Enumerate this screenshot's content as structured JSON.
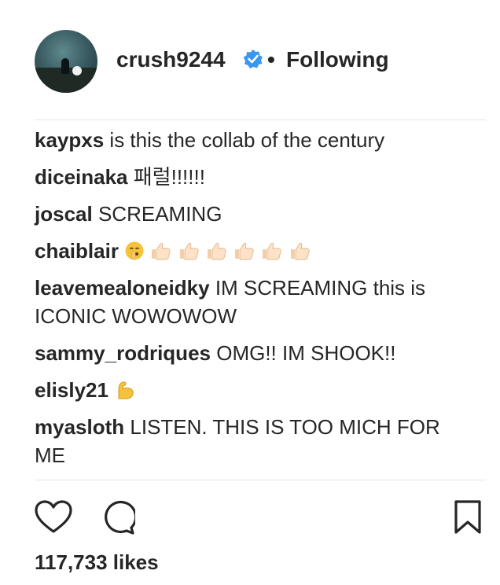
{
  "post": {
    "author": {
      "username": "crush9244",
      "verified": true,
      "separator": "•",
      "follow_status": "Following"
    },
    "comments": [
      {
        "user": "kaypxs",
        "text": "is this the collab of the century"
      },
      {
        "user": "diceinaka",
        "text": "패럴!!!!!!"
      },
      {
        "user": "joscal",
        "text": "SCREAMING"
      },
      {
        "user": "chaiblair",
        "text": "",
        "emojis": [
          "shushing-face-emoji",
          "thumbs-up-emoji",
          "thumbs-up-emoji",
          "thumbs-up-emoji",
          "thumbs-up-emoji",
          "thumbs-up-emoji",
          "thumbs-up-emoji"
        ]
      },
      {
        "user": "leavemealoneidky",
        "text": "IM SCREAMING this is ICONIC WOWOWOW"
      },
      {
        "user": "sammy_rodriques",
        "text": "OMG!! IM SHOOK!!"
      },
      {
        "user": "elisly21",
        "text": "",
        "emojis": [
          "flexed-biceps-emoji"
        ]
      },
      {
        "user": "myasloth",
        "text": "LISTEN. THIS IS TOO MICH FOR ME"
      }
    ],
    "actions": {
      "icons": [
        "heart-icon",
        "comment-icon",
        "bookmark-icon"
      ]
    },
    "likes": "117,733 likes"
  },
  "colors": {
    "text": "#262626",
    "verified_blue": "#3897f0",
    "divider": "#e6e6e6",
    "skin_tone": "#fde2c8",
    "emoji_yellow": "#f5c33b"
  }
}
